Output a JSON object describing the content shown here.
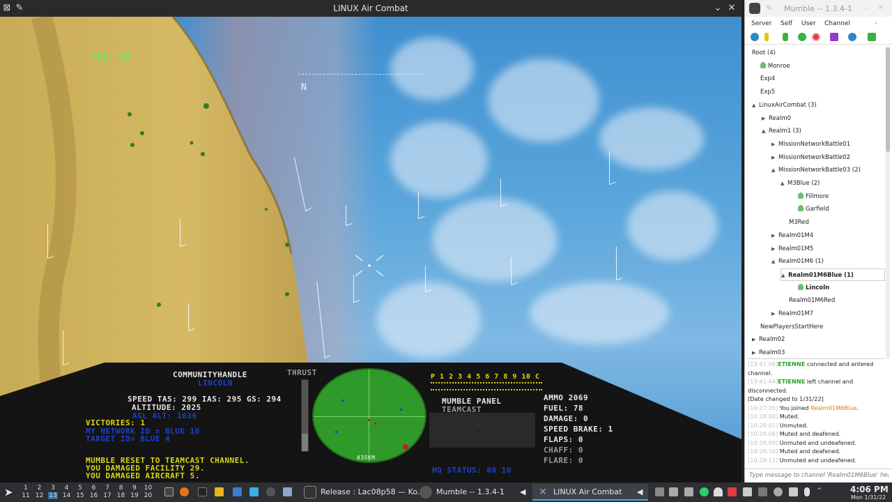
{
  "game_window": {
    "title": "LINUX Air Combat",
    "fps": "FPS: 60",
    "compass_heading": "N"
  },
  "hud": {
    "callsign": "COMMUNITYHANDLE",
    "pilot": "LINCOLN",
    "thrust_label": "THRUST",
    "thrust_level": 0.25,
    "speed_line": "SPEED  TAS: 299  IAS: 295  GS: 294",
    "altitude": "ALTITUDE: 2025",
    "agl": "AGL ALT: 1636",
    "victories": "VICTORIES: 1",
    "network_id": "MY NETWORK ID = BLUE 10",
    "target_id": "TARGET ID= BLUE 4",
    "messages": [
      "MUMBLE RESET TO TEAMCAST CHANNEL.",
      "YOU DAMAGED FACILITY 29.",
      "YOU DAMAGED AIRCRAFT 5."
    ],
    "radar_range": "035KM",
    "channel_numbers": "P  1 2 3 4 5 6 7 8 9 10      C",
    "mumble_panel": "MUMBLE PANEL",
    "teamcast": "TEAMCAST",
    "hq_status": "HQ STATUS:  00  10",
    "ammo": "AMMO 2069",
    "fuel": "FUEL:   78",
    "damage": "DAMAGE:    0",
    "speed_brake": "SPEED BRAKE: 1",
    "flaps": "FLAPS:  0",
    "chaff": "CHAFF:  0",
    "flare": "FLARE:  0"
  },
  "mumble": {
    "title": "Mumble -- 1.3.4-1",
    "menu": [
      "Server",
      "Self",
      "User",
      "Channel"
    ],
    "tree": [
      {
        "label": "Root (4)",
        "indent": 0,
        "arrow": "",
        "type": "channel"
      },
      {
        "label": "Monroe",
        "indent": 1,
        "arrow": "",
        "type": "user"
      },
      {
        "label": "Exp4",
        "indent": 1,
        "arrow": "",
        "type": "channel"
      },
      {
        "label": "Exp5",
        "indent": 1,
        "arrow": "",
        "type": "channel"
      },
      {
        "label": "LinuxAirCombat (3)",
        "indent": 1,
        "arrow": "▲",
        "type": "channel"
      },
      {
        "label": "Realm0",
        "indent": 2,
        "arrow": "▶",
        "type": "channel"
      },
      {
        "label": "Realm1 (3)",
        "indent": 2,
        "arrow": "▲",
        "type": "channel"
      },
      {
        "label": "MissionNetworkBattle01",
        "indent": 3,
        "arrow": "▶",
        "type": "channel"
      },
      {
        "label": "MissionNetworkBattle02",
        "indent": 3,
        "arrow": "▶",
        "type": "channel"
      },
      {
        "label": "MissionNetworkBattle03 (2)",
        "indent": 3,
        "arrow": "▲",
        "type": "channel"
      },
      {
        "label": "M3Blue (2)",
        "indent": 4,
        "arrow": "▲",
        "type": "channel"
      },
      {
        "label": "Fillmore",
        "indent": 5,
        "arrow": "",
        "type": "user"
      },
      {
        "label": "Garfield",
        "indent": 5,
        "arrow": "",
        "type": "user"
      },
      {
        "label": "M3Red",
        "indent": 4,
        "arrow": "",
        "type": "channel"
      },
      {
        "label": "Realm01M4",
        "indent": 3,
        "arrow": "▶",
        "type": "channel"
      },
      {
        "label": "Realm01M5",
        "indent": 3,
        "arrow": "▶",
        "type": "channel"
      },
      {
        "label": "Realm01M6 (1)",
        "indent": 3,
        "arrow": "▲",
        "type": "channel"
      },
      {
        "label": "Realm01M6Blue (1)",
        "indent": 4,
        "arrow": "▲",
        "type": "channel-bold"
      },
      {
        "label": "Lincoln",
        "indent": 5,
        "arrow": "",
        "type": "user-bold"
      },
      {
        "label": "Realm01M6Red",
        "indent": 4,
        "arrow": "",
        "type": "channel"
      },
      {
        "label": "Realm01M7",
        "indent": 3,
        "arrow": "▶",
        "type": "channel"
      },
      {
        "label": "NewPlayersStartHere",
        "indent": 1,
        "arrow": "",
        "type": "channel"
      },
      {
        "label": "Realm02",
        "indent": 1,
        "arrow": "▶",
        "type": "channel"
      },
      {
        "label": "Realm03",
        "indent": 1,
        "arrow": "▶",
        "type": "channel"
      }
    ],
    "log": [
      {
        "ts": "[13:41:06]",
        "name": "ETIENNE",
        "text": " connected and entered channel."
      },
      {
        "ts": "[13:41:44]",
        "name": "ETIENNE",
        "text": " left channel and disconnected."
      },
      {
        "ts": "",
        "name": "",
        "text": "[Date changed to 1/31/22]"
      },
      {
        "ts": "[10:27:20]",
        "name": "",
        "text": " You joined ",
        "channel": "Realm01M6Blue",
        "tail": "."
      },
      {
        "ts": "[10:28:00]",
        "name": "",
        "text": " Muted."
      },
      {
        "ts": "[10:28:01]",
        "name": "",
        "text": " Unmuted."
      },
      {
        "ts": "[10:28:06]",
        "name": "",
        "text": " Muted and deafened."
      },
      {
        "ts": "[10:28:09]",
        "name": "",
        "text": " Unmuted and undeafened."
      },
      {
        "ts": "[10:28:10]",
        "name": "",
        "text": " Muted and deafened."
      },
      {
        "ts": "[10:28:11]",
        "name": "",
        "text": " Unmuted and undeafened."
      }
    ],
    "message_placeholder": "Type message to channel 'Realm01M6Blue' here"
  },
  "taskbar": {
    "workspaces_top": [
      "1",
      "2",
      "3",
      "4",
      "5",
      "6",
      "7",
      "8",
      "9",
      "10"
    ],
    "workspaces_bottom": [
      "11",
      "12",
      "13",
      "14",
      "15",
      "16",
      "17",
      "18",
      "19",
      "20"
    ],
    "tasks": [
      {
        "label": "Release : Lac08p58 — Ko..."
      },
      {
        "label": "Mumble -- 1.3.4-1"
      },
      {
        "label": "LINUX Air Combat"
      }
    ],
    "time": "4:06 PM",
    "date": "Mon 1/31/22"
  }
}
